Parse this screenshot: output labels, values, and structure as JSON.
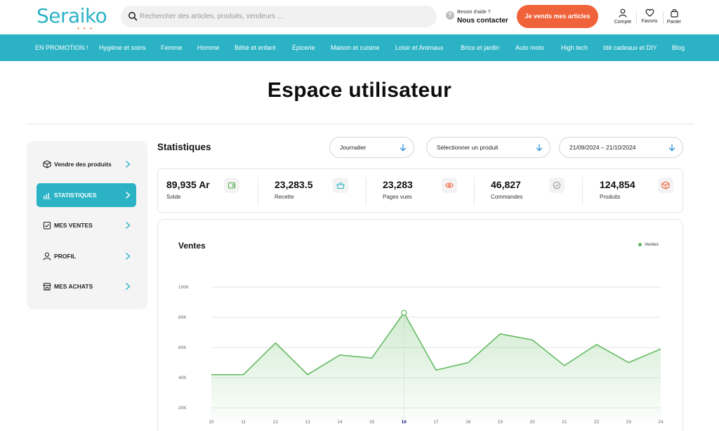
{
  "header": {
    "logo": "Seraiko",
    "logo_dots": "• • •",
    "search_placeholder": "Rechercher des articles, produits, vendeurs ...",
    "help_line1": "Besoin d'aide ?",
    "help_line2": "Nous contacter",
    "help_badge": "?",
    "sell_button": "Je vends mes articles",
    "account_label": "Compte",
    "favorites_label": "Favoris",
    "cart_label": "Panier"
  },
  "nav": {
    "items": [
      "EN PROMOTION !",
      "Hygiène et soins",
      "Femme",
      "Homme",
      "Bébé et enfant",
      "Épicerie",
      "Maison et cuisine",
      "Loisir et Animaux",
      "Brico et jardin",
      "Auto moto",
      "High tech",
      "Idé cadeaux et DIY",
      "Blog"
    ]
  },
  "page": {
    "title": "Espace utilisateur"
  },
  "sidebar": {
    "items": [
      {
        "label": "Vendre des produits",
        "icon": "box-icon",
        "active": false
      },
      {
        "label": "STATISTIQUES",
        "icon": "bar-chart-icon",
        "active": true
      },
      {
        "label": "MES VENTES",
        "icon": "checklist-icon",
        "active": false
      },
      {
        "label": "PROFIL",
        "icon": "user-icon",
        "active": false
      },
      {
        "label": "MES ACHATS",
        "icon": "store-icon",
        "active": false
      }
    ]
  },
  "stats": {
    "title": "Statistiques",
    "period_select": "Journalier",
    "product_select": "Sélectionner un produit",
    "date_range_select": "21/09/2024 – 21/10/2024"
  },
  "kpis": [
    {
      "value": "89,935 Ar",
      "label": "Solde",
      "icon": "wallet-icon",
      "icon_color": "#4caf50"
    },
    {
      "value": "23,283.5",
      "label": "Recette",
      "icon": "basket-icon",
      "icon_color": "#2bb3c5"
    },
    {
      "value": "23,283",
      "label": "Pages vues",
      "icon": "eye-icon",
      "icon_color": "#f0623a"
    },
    {
      "value": "46,827",
      "label": "Commandes",
      "icon": "check-circle-icon",
      "icon_color": "#9e9e9e"
    },
    {
      "value": "124,854",
      "label": "Produits",
      "icon": "cube-icon",
      "icon_color": "#f0623a"
    }
  ],
  "colors": {
    "brand": "#2bb3c5",
    "accent": "#f0623a",
    "line": "#5cb85c"
  },
  "chart_data": {
    "type": "area",
    "title": "Ventes",
    "legend": [
      "Ventes"
    ],
    "legend_position": "top-right",
    "x": [
      "10",
      "11",
      "12",
      "13",
      "14",
      "15",
      "16",
      "17",
      "18",
      "19",
      "20",
      "21",
      "22",
      "23",
      "24"
    ],
    "highlight_x": "16",
    "series": [
      {
        "name": "Ventes",
        "values": [
          42000,
          42000,
          63000,
          42000,
          55000,
          53000,
          83000,
          45000,
          50000,
          69000,
          65000,
          48000,
          62000,
          50000,
          59000
        ]
      }
    ],
    "yticks": [
      "100K",
      "80K",
      "60K",
      "40K",
      "20K"
    ],
    "ytick_values": [
      100000,
      80000,
      60000,
      40000,
      20000
    ],
    "ylim": [
      20000,
      100000
    ],
    "grid": true
  }
}
